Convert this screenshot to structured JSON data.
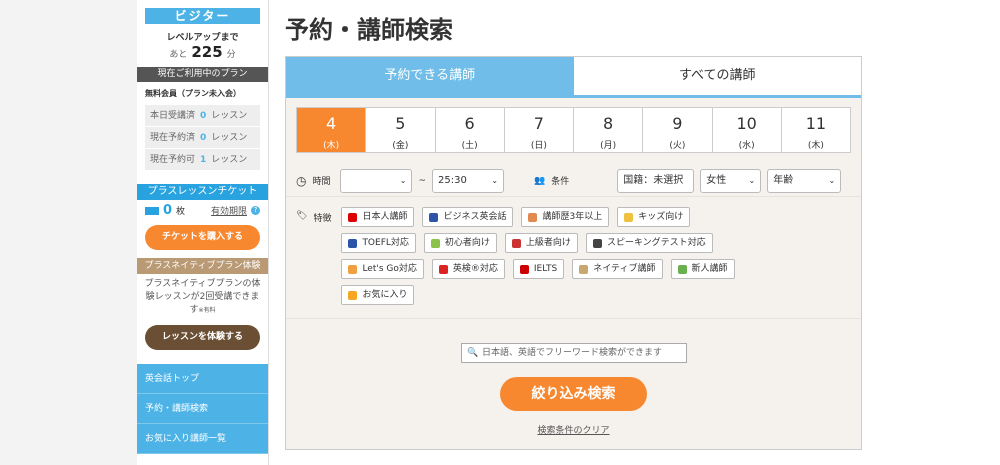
{
  "sidebar": {
    "rank": "ビジター",
    "levelup_label": "レベルアップまで",
    "remaining_prefix": "あと",
    "remaining_value": "225",
    "remaining_unit": "分",
    "plan_header": "現在ご利用中のプラン",
    "plan_name": "無料会員（プラン未入会）",
    "stats": [
      {
        "label": "本日受講済",
        "value": "0",
        "unit": "レッスン"
      },
      {
        "label": "現在予約済",
        "value": "0",
        "unit": "レッスン"
      },
      {
        "label": "現在予約可",
        "value": "1",
        "unit": "レッスン"
      }
    ],
    "ticket_header": "プラスレッスンチケット",
    "ticket_count": "0",
    "ticket_unit": "枚",
    "ticket_expiry": "有効期限",
    "ticket_help": "?",
    "ticket_button": "チケットを購入する",
    "native_header": "プラスネイティブプラン体験",
    "native_text": "プラスネイティブプランの体験レッスンが2回受講できます",
    "native_note": "※有料",
    "native_button": "レッスンを体験する",
    "nav": [
      "英会話トップ",
      "予約・講師検索",
      "お気に入り講師一覧"
    ]
  },
  "main": {
    "title": "予約・講師検索",
    "tabs": [
      "予約できる講師",
      "すべての講師"
    ],
    "dates": [
      {
        "n": "4",
        "w": "(木)"
      },
      {
        "n": "5",
        "w": "(金)"
      },
      {
        "n": "6",
        "w": "(土)"
      },
      {
        "n": "7",
        "w": "(日)"
      },
      {
        "n": "8",
        "w": "(月)"
      },
      {
        "n": "9",
        "w": "(火)"
      },
      {
        "n": "10",
        "w": "(水)"
      },
      {
        "n": "11",
        "w": "(木)"
      }
    ],
    "time_label": "時間",
    "time_from": "",
    "time_sep": "~",
    "time_to": "25:30",
    "cond_label": "条件",
    "nationality": "国籍：未選択",
    "gender": "女性",
    "age": "年齢",
    "feature_label": "特徴",
    "features": [
      {
        "label": "日本人講師",
        "color": "#d00"
      },
      {
        "label": "ビジネス英会話",
        "color": "#2b55a8"
      },
      {
        "label": "講師歴3年以上",
        "color": "#e08a50"
      },
      {
        "label": "キッズ向け",
        "color": "#f0c040"
      },
      {
        "label": "TOEFL対応",
        "color": "#2b55a8"
      },
      {
        "label": "初心者向け",
        "color": "#8bc34a"
      },
      {
        "label": "上級者向け",
        "color": "#c33"
      },
      {
        "label": "スピーキングテスト対応",
        "color": "#444"
      },
      {
        "label": "Let's Go対応",
        "color": "#f0a040"
      },
      {
        "label": "英検®対応",
        "color": "#d22"
      },
      {
        "label": "IELTS",
        "color": "#c00"
      },
      {
        "label": "ネイティブ講師",
        "color": "#c8a870"
      },
      {
        "label": "新人講師",
        "color": "#6ab04c"
      },
      {
        "label": "お気に入り",
        "color": "#f5a623"
      }
    ],
    "search_placeholder": "日本語、英語でフリーワード検索ができます",
    "search_button": "絞り込み検索",
    "clear_link": "検索条件のクリア"
  }
}
